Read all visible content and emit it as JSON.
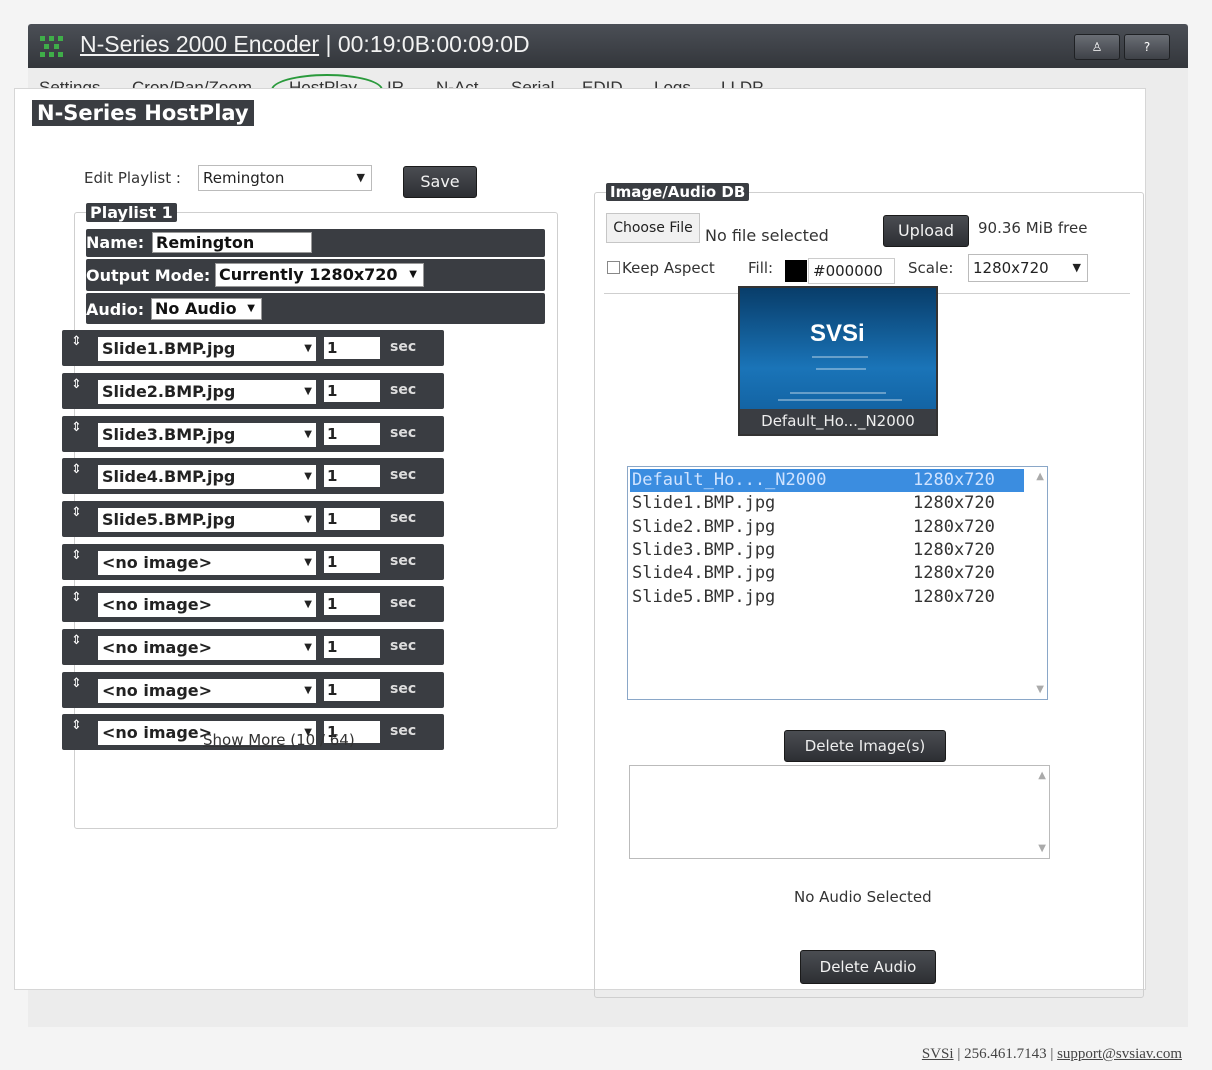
{
  "window": {
    "app_name": "N-Series 2000 Encoder",
    "separator": " | ",
    "mac": "00:19:0B:00:09:0D",
    "btn_user": "♙",
    "btn_help": "?"
  },
  "nav": {
    "items": [
      "Settings",
      "Crop/Pan/Zoom",
      "HostPlay",
      "IR",
      "N-Act",
      "Serial",
      "EDID",
      "Logs",
      "LLDP"
    ],
    "active": "HostPlay",
    "active_highlight_color": "#2a9a3c"
  },
  "page_title": "N-Series HostPlay",
  "edit_playlist": {
    "label": "Edit Playlist :",
    "value": "Remington",
    "save_label": "Save"
  },
  "playlist": {
    "legend": "Playlist 1",
    "name_label": "Name:",
    "name_value": "Remington",
    "output_mode_label": "Output Mode:",
    "output_mode_value": "Currently 1280x720",
    "audio_label": "Audio:",
    "audio_value": "No Audio",
    "unit": "sec",
    "slides": [
      {
        "image": "Slide1.BMP.jpg",
        "duration": "1"
      },
      {
        "image": "Slide2.BMP.jpg",
        "duration": "1"
      },
      {
        "image": "Slide3.BMP.jpg",
        "duration": "1"
      },
      {
        "image": "Slide4.BMP.jpg",
        "duration": "1"
      },
      {
        "image": "Slide5.BMP.jpg",
        "duration": "1"
      },
      {
        "image": "<no image>",
        "duration": "1"
      },
      {
        "image": "<no image>",
        "duration": "1"
      },
      {
        "image": "<no image>",
        "duration": "1"
      },
      {
        "image": "<no image>",
        "duration": "1"
      },
      {
        "image": "<no image>",
        "duration": "1"
      }
    ],
    "show_more": "Show More",
    "count": "(10 / 64)"
  },
  "db": {
    "legend": "Image/Audio DB",
    "choose_file": "Choose File",
    "no_file": "No file selected",
    "upload": "Upload",
    "free": "90.36 MiB free",
    "keep_aspect": "Keep Aspect",
    "fill_label": "Fill:",
    "fill_value": "#000000",
    "scale_label": "Scale:",
    "scale_value": "1280x720",
    "thumb_brand": "SVSi",
    "thumb_caption": "Default_Ho..._N2000",
    "images": [
      {
        "name": "Default_Ho..._N2000",
        "res": "1280x720"
      },
      {
        "name": "Slide1.BMP.jpg",
        "res": "1280x720"
      },
      {
        "name": "Slide2.BMP.jpg",
        "res": "1280x720"
      },
      {
        "name": "Slide3.BMP.jpg",
        "res": "1280x720"
      },
      {
        "name": "Slide4.BMP.jpg",
        "res": "1280x720"
      },
      {
        "name": "Slide5.BMP.jpg",
        "res": "1280x720"
      }
    ],
    "delete_images": "Delete Image(s)",
    "no_audio": "No Audio Selected",
    "delete_audio": "Delete Audio"
  },
  "footer": {
    "brand": "SVSi",
    "sep1": " | 256.461.7143 | ",
    "email": "support@svsiav.com"
  }
}
